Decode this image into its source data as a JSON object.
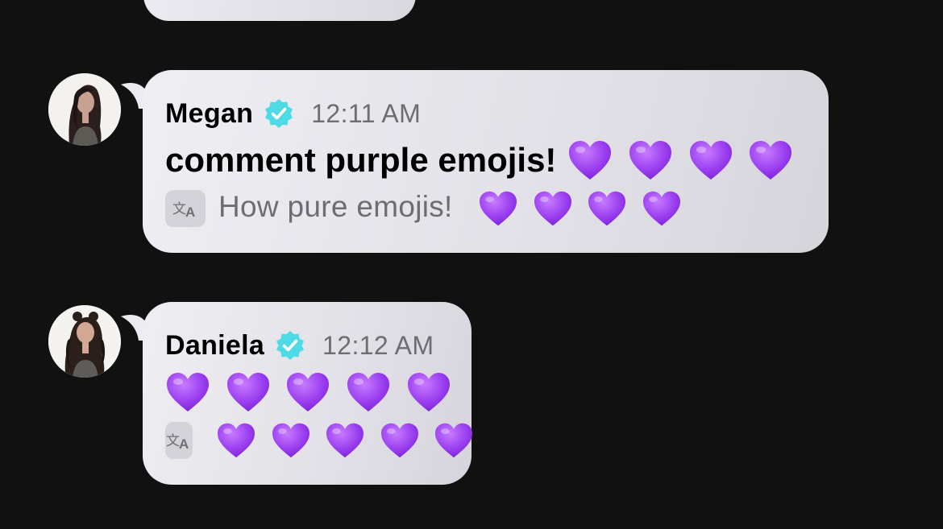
{
  "colors": {
    "background": "#111112",
    "bubble": "#e6e5eb",
    "verified": "#4fdbe6",
    "heart": "#9b3ff0",
    "muted_text": "#6e6d73"
  },
  "messages": [
    {
      "sender": "Megan",
      "verified": true,
      "timestamp": "12:11 AM",
      "text": "comment purple emojis!",
      "text_emojis": [
        "💜",
        "💜",
        "💜",
        "💜"
      ],
      "translation": "How pure emojis!",
      "translation_emojis": [
        "💜",
        "💜",
        "💜",
        "💜"
      ]
    },
    {
      "sender": "Daniela",
      "verified": true,
      "timestamp": "12:12 AM",
      "text": "",
      "text_emojis": [
        "💜",
        "💜",
        "💜",
        "💜",
        "💜"
      ],
      "translation": "",
      "translation_emojis": [
        "💜",
        "💜",
        "💜",
        "💜",
        "💜"
      ]
    }
  ],
  "icons": {
    "verified": "verified-badge-icon",
    "translate": "translate-icon",
    "heart": "purple-heart-emoji"
  }
}
